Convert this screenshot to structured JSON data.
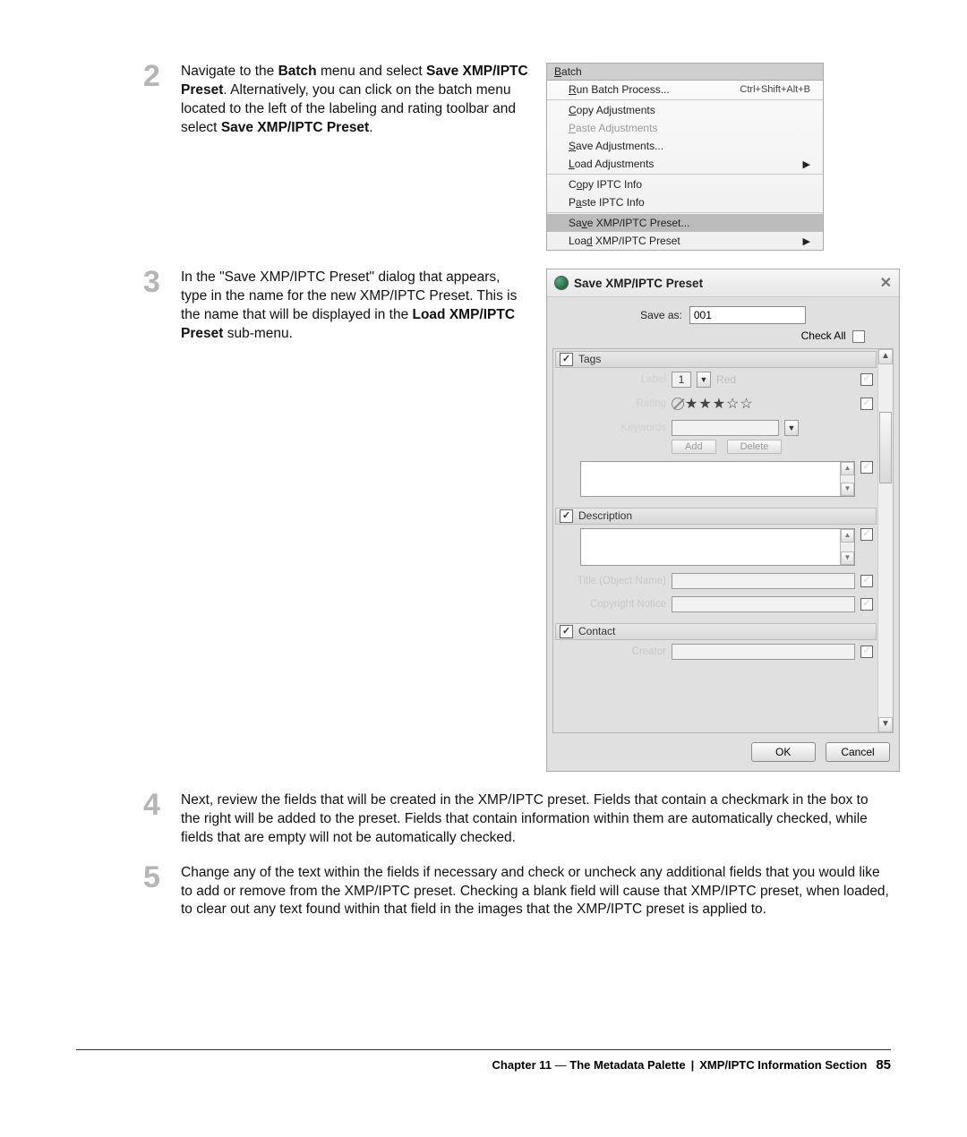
{
  "steps": {
    "s2": {
      "num": "2"
    },
    "s3": {
      "num": "3"
    },
    "s4": {
      "num": "4",
      "text": "Next, review the fields that will be created in the XMP/IPTC preset. Fields that contain a checkmark in the box to the right will be added to the preset. Fields that contain information within them are automatically checked, while fields that are empty will not be automatically checked."
    },
    "s5": {
      "num": "5",
      "text": "Change any of the text within the fields if necessary and check or uncheck any additional fields that you would like to add or remove from the XMP/IPTC preset. Checking a blank field will cause that XMP/IPTC preset, when loaded, to clear out any text found within that field in the images that the XMP/IPTC preset is applied to."
    }
  },
  "step2_parts": {
    "a": "Navigate to the ",
    "batch": "Batch",
    "b": " menu and select ",
    "save1": "Save XMP/IPTC Preset",
    "c": ". Alternatively, you can click on the batch menu located to the left of the labeling and rating toolbar and select ",
    "save2": "Save XMP/IPTC Preset",
    "d": "."
  },
  "step3_parts": {
    "a": "In the \"Save XMP/IPTC Preset\" dialog that appears, type in the name for the new XMP/IPTC Preset. This is the name that will be displayed in the ",
    "load": "Load XMP/IPTC Preset",
    "b": " sub-menu."
  },
  "menu": {
    "title": "Batch",
    "title_u": "B",
    "items": {
      "run": {
        "pre": "",
        "u": "R",
        "post": "un Batch Process...",
        "shortcut": "Ctrl+Shift+Alt+B"
      },
      "copy": {
        "pre": "",
        "u": "C",
        "post": "opy Adjustments"
      },
      "paste": {
        "pre": "",
        "u": "P",
        "post": "aste Adjustments"
      },
      "saveadj": {
        "pre": "",
        "u": "S",
        "post": "ave Adjustments..."
      },
      "loadadj": {
        "pre": "",
        "u": "L",
        "post": "oad Adjustments"
      },
      "copyiptc": {
        "pre": "C",
        "u": "o",
        "post": "py IPTC Info"
      },
      "pasteiptc": {
        "pre": "P",
        "u": "a",
        "post": "ste IPTC Info"
      },
      "savexmp": {
        "pre": "Sa",
        "u": "v",
        "post": "e XMP/IPTC Preset..."
      },
      "loadxmp": {
        "pre": "Loa",
        "u": "d",
        "post": " XMP/IPTC Preset"
      }
    }
  },
  "dialog": {
    "title": "Save XMP/IPTC Preset",
    "save_as_label": "Save as:",
    "save_as_value": "001",
    "check_all": "Check All",
    "sections": {
      "tags": "Tags",
      "description": "Description",
      "contact": "Contact"
    },
    "fields": {
      "label": "Label",
      "label_value": "1",
      "label_color": "Red",
      "rating": "Rating",
      "keywords": "Keywords",
      "add": "Add",
      "delete": "Delete",
      "title_obj": "Title (Object Name)",
      "copyright": "Copyright Notice",
      "creator": "Creator"
    },
    "buttons": {
      "ok": "OK",
      "cancel": "Cancel"
    }
  },
  "footer": {
    "chapter": "Chapter 11",
    "dash": " — ",
    "title": "The Metadata Palette",
    "section": "XMP/IPTC Information Section",
    "page": "85"
  }
}
